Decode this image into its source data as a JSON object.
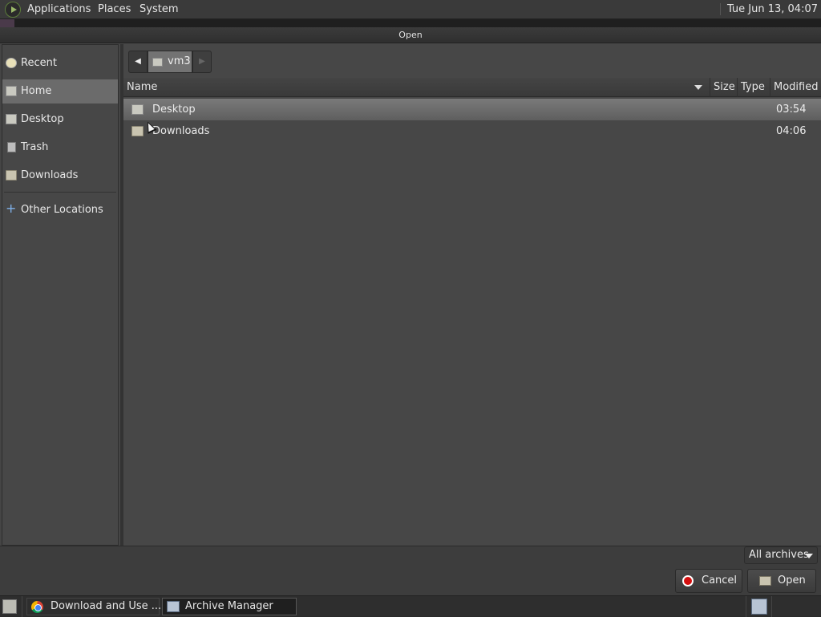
{
  "topbar": {
    "menus": [
      "Applications",
      "Places",
      "System"
    ],
    "clock": "Tue Jun 13, 04:07"
  },
  "dialog": {
    "title": "Open",
    "sidebar": [
      {
        "label": "Recent",
        "icon": "recent-icon"
      },
      {
        "label": "Home",
        "icon": "home-icon",
        "active": true
      },
      {
        "label": "Desktop",
        "icon": "desktop-icon"
      },
      {
        "label": "Trash",
        "icon": "trash-icon"
      },
      {
        "label": "Downloads",
        "icon": "folder-icon"
      },
      {
        "label": "Other Locations",
        "icon": "plus-icon"
      }
    ],
    "path": {
      "current": "vm3"
    },
    "columns": [
      "Name",
      "Size",
      "Type",
      "Modified"
    ],
    "files": [
      {
        "name": "Desktop",
        "size": "",
        "type": "",
        "modified": "03:54",
        "icon": "desktop-folder-icon",
        "selected": true
      },
      {
        "name": "Downloads",
        "size": "",
        "type": "",
        "modified": "04:06",
        "icon": "folder-icon",
        "selected": false
      }
    ],
    "filter": "All archives",
    "buttons": {
      "cancel": "Cancel",
      "open": "Open"
    }
  },
  "taskbar": {
    "tasks": [
      {
        "label": "Download and Use ...",
        "icon": "chrome-icon",
        "active": false
      },
      {
        "label": "Archive Manager",
        "icon": "archive-manager-icon",
        "active": true
      }
    ]
  }
}
